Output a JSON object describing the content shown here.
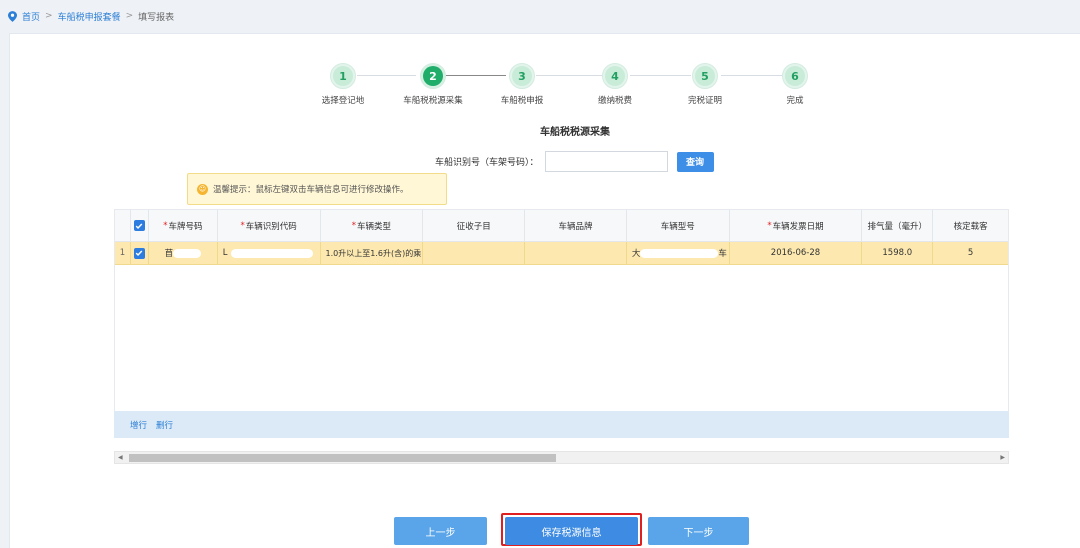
{
  "breadcrumb": {
    "home": "首页",
    "sep1": ">",
    "parent": "车船税申报套餐",
    "sep2": ">",
    "current": "填写报表"
  },
  "steps": [
    {
      "num": "1",
      "label": "选择登记地"
    },
    {
      "num": "2",
      "label": "车船税税源采集"
    },
    {
      "num": "3",
      "label": "车船税申报"
    },
    {
      "num": "4",
      "label": "缴纳税费"
    },
    {
      "num": "5",
      "label": "完税证明"
    },
    {
      "num": "6",
      "label": "完成"
    }
  ],
  "active_step": 2,
  "section_title": "车船税税源采集",
  "search": {
    "label": "车船识别号（车架号码）：",
    "value": "",
    "button": "查询"
  },
  "tip": "温馨提示：鼠标左键双击车辆信息可进行修改操作。",
  "table": {
    "headers": [
      {
        "text": "车牌号码",
        "required": true
      },
      {
        "text": "车辆识别代码",
        "required": true
      },
      {
        "text": "车辆类型",
        "required": true
      },
      {
        "text": "征收子目",
        "required": false
      },
      {
        "text": "车辆品牌",
        "required": false
      },
      {
        "text": "车辆型号",
        "required": false
      },
      {
        "text": "车辆发票日期",
        "required": true
      },
      {
        "text": "排气量（毫升）",
        "required": false
      },
      {
        "text": "核定载客",
        "required": false
      }
    ],
    "required_mark": "*",
    "rows": [
      {
        "index": "1",
        "checked": true,
        "plate": "苜",
        "vin": "L",
        "type": "1.0升以上至1.6升(含)的乘",
        "sub_item": "",
        "brand": "",
        "model_prefix": "大",
        "model_suffix": "车",
        "invoice_date": "2016-06-28",
        "displacement": "1598.0",
        "passengers": "5"
      }
    ]
  },
  "grid_toolbar": {
    "add_row": "增行",
    "delete_row": "删行"
  },
  "buttons": {
    "prev": "上一步",
    "save": "保存税源信息",
    "next": "下一步"
  },
  "colors": {
    "accent": "#3d8be2",
    "step_active": "#1fad69",
    "row_selected": "#fde9b0",
    "highlight": "#e02020"
  }
}
